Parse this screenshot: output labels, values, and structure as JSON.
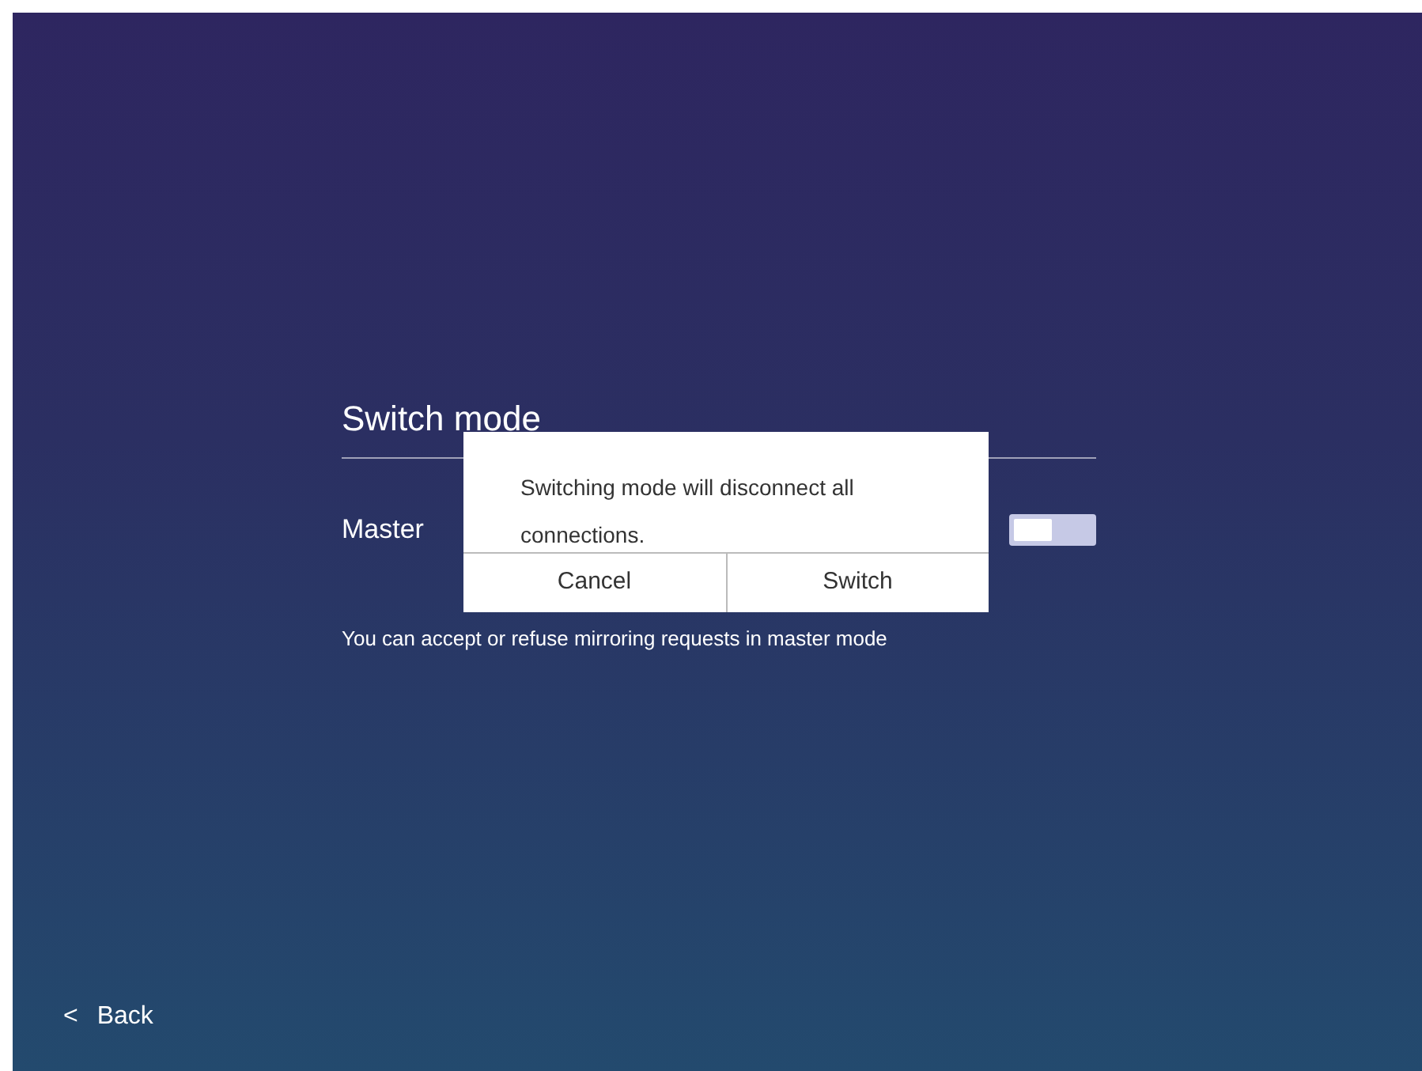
{
  "title": "Switch mode",
  "setting": {
    "label": "Master",
    "on": false,
    "hint": "You can accept or refuse mirroring requests in master mode"
  },
  "dialog": {
    "message": "Switching mode will disconnect all connections.",
    "buttons": [
      "Cancel",
      "Switch"
    ]
  },
  "back": {
    "icon": "<",
    "label": "Back"
  }
}
